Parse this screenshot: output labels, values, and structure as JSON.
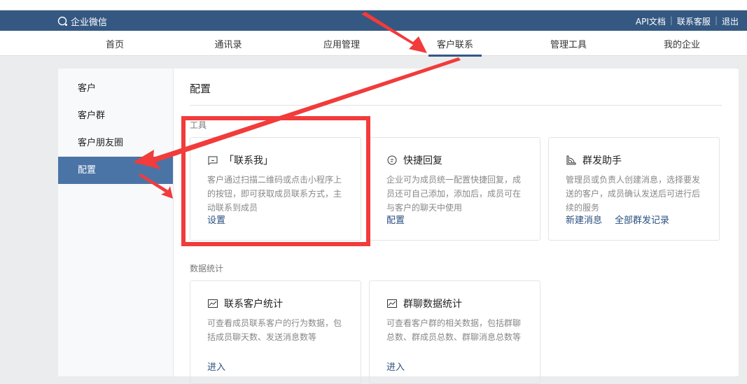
{
  "header": {
    "logo": "企业微信",
    "links": [
      "API文档",
      "联系客服",
      "退出"
    ]
  },
  "nav": {
    "items": [
      "首页",
      "通讯录",
      "应用管理",
      "客户联系",
      "管理工具",
      "我的企业"
    ],
    "active": 3
  },
  "sidebar": {
    "items": [
      "客户",
      "客户群",
      "客户朋友圈",
      "配置"
    ],
    "active": 3
  },
  "main": {
    "title": "配置",
    "tools_label": "工具",
    "tools": [
      {
        "title": "「联系我」",
        "icon": "contact-me-icon",
        "desc": "客户通过扫描二维码或点击小程序上的按钮，即可获取成员联系方式，主动联系到成员",
        "links": [
          "设置"
        ]
      },
      {
        "title": "快捷回复",
        "icon": "quick-reply-icon",
        "desc": "企业可为成员统一配置快捷回复，成员还可自己添加，添加后，成员可在与客户的聊天中使用",
        "links": [
          "配置"
        ]
      },
      {
        "title": "群发助手",
        "icon": "broadcast-icon",
        "desc": "管理员或负责人创建消息，选择要发送的客户，成员确认发送后可进行后续的服务",
        "links": [
          "新建消息",
          "全部群发记录"
        ]
      }
    ],
    "stats_label": "数据统计",
    "stats": [
      {
        "title": "联系客户统计",
        "icon": "chart-icon",
        "desc": "可查看成员联系客户的行为数据，包括成员聊天数、发送消息数等",
        "links": [
          "进入"
        ]
      },
      {
        "title": "群聊数据统计",
        "icon": "chart-icon",
        "desc": "可查看客户群的相关数据，包括群聊总数、群成员总数、群聊消息总数等",
        "links": [
          "进入"
        ]
      }
    ]
  },
  "colors": {
    "header": "#345882",
    "accent": "#4a74a6",
    "annotation": "#f23b3b"
  }
}
